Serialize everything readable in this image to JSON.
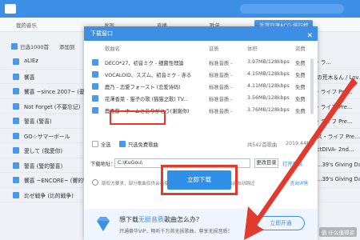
{
  "app": {
    "nav_tabs": [
      "我的音乐",
      "发现",
      "直播",
      "歌单",
      "手游日语ACG·排行榜"
    ],
    "toolbar": {
      "selected_label": "已选1000首",
      "add_label": "添加到"
    },
    "bg_rows": [
      {
        "title": "aLIEz",
        "right": ""
      },
      {
        "title": "響喜",
        "right": ""
      },
      {
        "title": "響喜 ~since 2007~ (憂歌 ~",
        "right": ""
      },
      {
        "title": "Not Forget (不要忘记)",
        "right": ""
      },
      {
        "title": "警喜 (警喜)",
        "right": ""
      },
      {
        "title": "GO☆サマーボール",
        "right": ""
      },
      {
        "title": "愛して (我愛你)",
        "right": ""
      },
      {
        "title": "警喜 (警的警喜)",
        "right": ""
      },
      {
        "title": "響喜 ~ENCORE~ (響的警喜",
        "right": ""
      },
      {
        "title": "比ゼ戦争 (比的戦争)",
        "right": ""
      }
    ],
    "bg_right": [
      "- ラ...",
      "の荒木＆ん / Lov...",
      "- ライフ Pre...",
      "- ライフ Pre...",
      "- ライフ Pre...",
      "ス・ライフ Pre...",
      "ctDIVA- 2nd...",
      "...39's Giving Day...",
      "...39's Giving Day..."
    ]
  },
  "dialog": {
    "title": "下载窗口",
    "close_icon": "close-icon",
    "columns": {
      "name": "歌曲名",
      "quality": "音质",
      "size": "体积",
      "fee": "资费"
    },
    "songs": [
      {
        "name": "DECO*27、初音ミク - 细菌性理論",
        "quality": "标准音质 -",
        "size": "3.97MB/128kbps",
        "fee": "免费"
      },
      {
        "name": "VOCALOID、スズム、初音ミク - 赤る",
        "quality": "标准音质 -",
        "size": "4.15MB/128kbps",
        "fee": "免费"
      },
      {
        "name": "鹿乃 - 恋愛フォースト (恋爱诗码)",
        "quality": "标准音质 -",
        "size": "4.11MB/128kbps",
        "fee": "免费"
      },
      {
        "name": "花澤香菜 - 猫子の歌 (猫猫之歌) TV...",
        "quality": "标准音质 -",
        "size": "3.56MB/128kbps",
        "fee": "免费"
      },
      {
        "name": "鹿喜藤 - ホームとありがとう(谢谢你)",
        "quality": "标准音质 -",
        "size": "3.76MB/128kbps",
        "fee": "免费"
      }
    ],
    "select_all": "全选",
    "free_only": "只选免费歌曲",
    "total": "共542首歌曲",
    "total_size": "2019.44MB",
    "download_dir_label": "下载地址：",
    "download_dir_value": "C:\\KuGou\\",
    "change_dir": "更改目录",
    "open_dir": "打开目录",
    "notice": "版权方要求，部分歌曲仅供会员使用，◎ 需要会员会员下载的歌曲会自动跳过",
    "notice_link": "查询详情",
    "download_button": "立即下载",
    "promo_title_prefix": "想下载",
    "promo_title_hl": "无损音质",
    "promo_title_suffix": "歌曲怎么办？",
    "promo_sub": "开通豪华VIP，畅听千万首无损歌曲，尊享无损音质！",
    "open_button": "立即开通",
    "diamond_icon": "diamond-icon"
  },
  "watermark": "值 什么值得买",
  "colors": {
    "brand": "#3d8fe6",
    "highlight": "#e23a2c"
  }
}
